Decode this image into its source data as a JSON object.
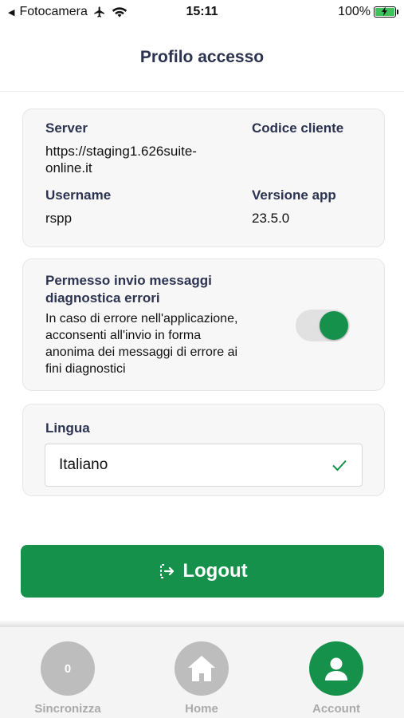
{
  "status_bar": {
    "back_app": "Fotocamera",
    "time": "15:11",
    "battery": "100%"
  },
  "header": {
    "title": "Profilo accesso"
  },
  "info": {
    "server_label": "Server",
    "server_value_line1": "https://staging1.626suite-",
    "server_value_line2": "online.it",
    "client_code_label": "Codice cliente",
    "username_label": "Username",
    "username_value": "rspp",
    "version_label": "Versione app",
    "version_value": "23.5.0"
  },
  "diagnostics": {
    "title_line1": "Permesso invio messaggi",
    "title_line2": "diagnostica errori",
    "text_line1": "In caso di errore nell'applicazione,",
    "text_line2": "acconsenti all'invio in forma",
    "text_line3": "anonima dei messaggi di errore ai",
    "text_line4": "fini diagnostici",
    "toggle_on": true
  },
  "language": {
    "label": "Lingua",
    "selected": "Italiano"
  },
  "logout": {
    "label": "Logout"
  },
  "tabbar": {
    "sync_label": "Sincronizza",
    "sync_count": "0",
    "home_label": "Home",
    "account_label": "Account"
  },
  "colors": {
    "accent": "#15914c",
    "title": "#2b3350",
    "inactive": "#bdbdbd"
  }
}
